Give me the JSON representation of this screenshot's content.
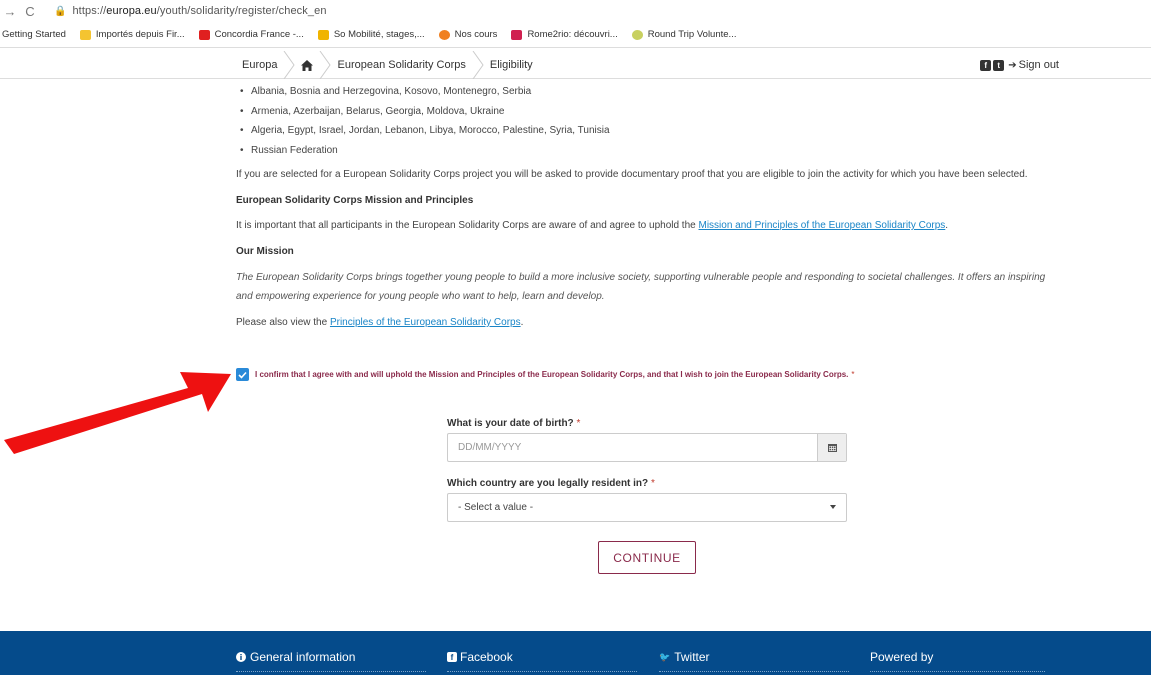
{
  "browser": {
    "url_prefix": "https://",
    "url_domain": "europa.eu",
    "url_path": "/youth/solidarity/register/check_en",
    "bookmarks": [
      {
        "label": "Getting Started",
        "color": ""
      },
      {
        "label": "Importés depuis Fir...",
        "color": "#f4c430"
      },
      {
        "label": "Concordia France -...",
        "color": "#e02020"
      },
      {
        "label": "So Mobilité, stages,...",
        "color": "#f0b400"
      },
      {
        "label": "Nos cours",
        "color": "#f08020"
      },
      {
        "label": "Rome2rio: découvri...",
        "color": "#d02050"
      },
      {
        "label": "Round Trip Volunte...",
        "color": "#c8d060"
      }
    ]
  },
  "header": {
    "breadcrumbs": [
      "Europa",
      "European Solidarity Corps",
      "Eligibility"
    ],
    "sign_out": "Sign out"
  },
  "content": {
    "countries": [
      "Albania, Bosnia and Herzegovina, Kosovo, Montenegro, Serbia",
      "Armenia, Azerbaijan, Belarus, Georgia, Moldova, Ukraine",
      "Algeria, Egypt, Israel, Jordan, Lebanon, Libya, Morocco, Palestine, Syria, Tunisia",
      "Russian Federation"
    ],
    "proof_text": "If you are selected for a European Solidarity Corps project you will be asked to provide documentary proof that you are eligible to join the activity for which you have been selected.",
    "mission_heading": "European Solidarity Corps Mission and Principles",
    "mission_intro": "It is important that all participants in the European Solidarity Corps are aware of and agree to uphold the ",
    "mission_link": "Mission and Principles of the European Solidarity Corps",
    "our_mission_heading": "Our Mission",
    "mission_text_1": "The European Solidarity Corps brings together young people to build a more inclusive society, supporting vulnerable people and responding to societal challenges. It offers an inspiring",
    "mission_text_2": "and empowering experience for young people who want to help, learn and develop.",
    "principles_intro": "Please also view the ",
    "principles_link": "Principles of the European Solidarity Corps"
  },
  "confirm": {
    "label": "I confirm that I agree with and will uphold the Mission and Principles of the European Solidarity Corps, and that I wish to join the European Solidarity Corps.",
    "required": "*",
    "checked": true
  },
  "form": {
    "dob_label": "What is your date of birth?",
    "dob_placeholder": "DD/MM/YYYY",
    "country_label": "Which country are you legally resident in?",
    "country_value": "- Select a value -",
    "required": "*",
    "continue": "CONTINUE"
  },
  "footer": {
    "general": "General information",
    "facebook": "Facebook",
    "twitter": "Twitter",
    "powered": "Powered by"
  },
  "colors": {
    "accent": "#8a2a4b",
    "link": "#1a85c7",
    "footer": "#054b8b",
    "arrow": "#ee1111",
    "checkbox": "#2a8ad8"
  }
}
